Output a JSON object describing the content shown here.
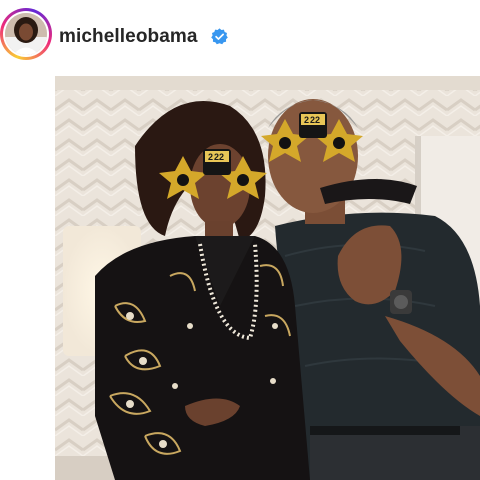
{
  "post": {
    "username": "michelleobama",
    "verified": true,
    "glasses_year_left": "22",
    "glasses_year_right": "22",
    "glasses_digit_left": "2",
    "glasses_digit_right": "2"
  },
  "colors": {
    "username": "#262626",
    "verified_badge": "#3897f0",
    "story_ring": [
      "#f9ce34",
      "#ee2a7b",
      "#6228d7"
    ],
    "glasses_gold": "#d4a82a",
    "wall": "#e9e1d8"
  },
  "icons": {
    "verified": "verified-badge-icon"
  }
}
